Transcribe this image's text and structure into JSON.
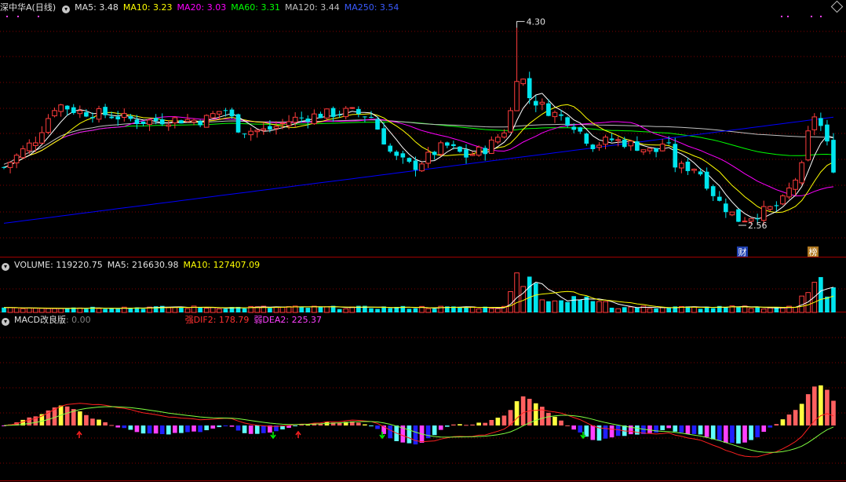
{
  "header": {
    "stock_name": "深中华A(日线)",
    "ma5": "MA5: 3.48",
    "ma10": "MA10: 3.23",
    "ma20": "MA20: 3.03",
    "ma60": "MA60: 3.31",
    "ma120": "MA120: 3.44",
    "ma250": "MA250: 3.54"
  },
  "volume_header": {
    "volume": "VOLUME: 119220.75",
    "ma5": "MA5: 216630.98",
    "ma10": "MA10: 127407.09"
  },
  "macd_header": {
    "name": "MACD改良版",
    "value": ": 0.00",
    "dif": "强DIF2: 178.79",
    "dea": "弱DEA2: 225.37"
  },
  "annotations": {
    "high": "4.30",
    "low": "2.56",
    "cai_badge": "财",
    "bang_badge": "榜"
  },
  "colors": {
    "up": "#ff3c3c",
    "down": "#00e5ee",
    "ma5": "#ffffff",
    "ma10": "#ffff00",
    "ma20": "#ff00ff",
    "ma60": "#00ff00",
    "ma120": "#c0c0c0",
    "ma250": "#0000ff",
    "grid": "#800000",
    "dif": "#ff2020",
    "dea": "#ffff00"
  },
  "chart_data": {
    "type": "candlestick",
    "price_ylim": [
      2.3,
      4.45
    ],
    "candle_count": 132,
    "high_value": 4.3,
    "low_value": 2.56
  }
}
